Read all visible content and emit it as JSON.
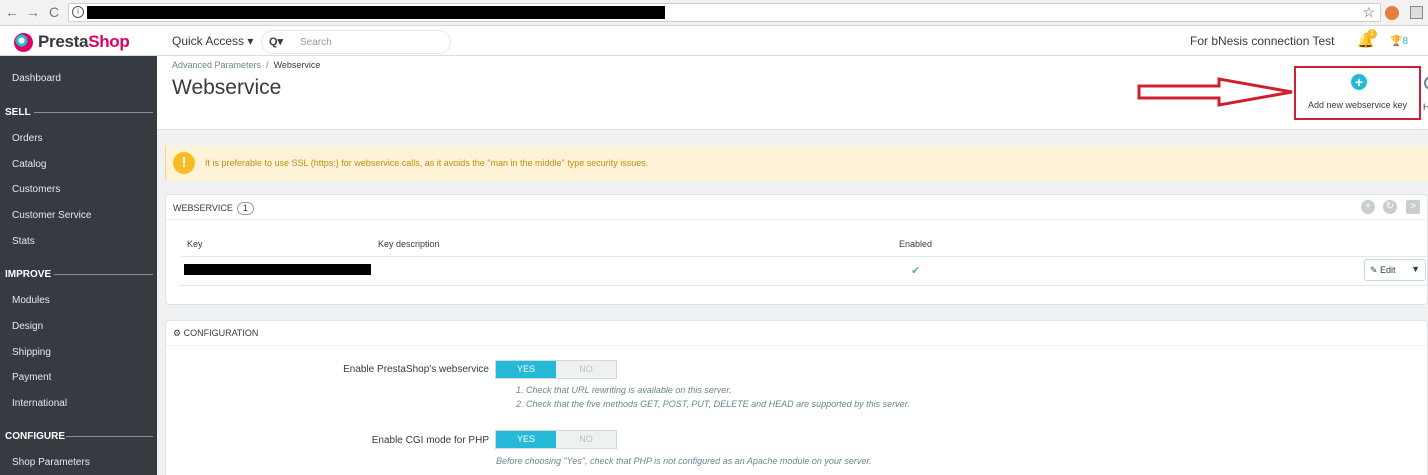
{
  "browser": {
    "back_icon": "←",
    "forward_icon": "→",
    "reload_icon": "C",
    "info_icon": "i",
    "star_icon": "☆"
  },
  "header": {
    "logo_presta": "Presta",
    "logo_shop": "Shop",
    "quick_access": "Quick Access ▾",
    "search_icon": "Q▾",
    "search_placeholder": "Search",
    "shop_name": "For bNesis connection Test",
    "bell_badge": "1",
    "trophy_count": "8"
  },
  "sidebar": {
    "dashboard": "Dashboard",
    "sections": [
      {
        "title": "SELL",
        "items": [
          "Orders",
          "Catalog",
          "Customers",
          "Customer Service",
          "Stats"
        ]
      },
      {
        "title": "IMPROVE",
        "items": [
          "Modules",
          "Design",
          "Shipping",
          "Payment",
          "International"
        ]
      },
      {
        "title": "CONFIGURE",
        "items": [
          "Shop Parameters"
        ]
      }
    ]
  },
  "page": {
    "breadcrumb_parent": "Advanced Parameters",
    "breadcrumb_sep": "/",
    "breadcrumb_current": "Webservice",
    "title": "Webservice",
    "add_key_label": "Add new webservice key",
    "help_stub": "H"
  },
  "alert": {
    "icon": "!",
    "text": "It is preferable to use SSL (https:) for webservice calls, as it avoids the \"man in the middle\" type security issues."
  },
  "webservice_panel": {
    "title": "WEBSERVICE",
    "count": "1",
    "columns": [
      "Key",
      "Key description",
      "Enabled"
    ],
    "row": {
      "enabled_icon": "✔"
    },
    "edit_label": "✎ Edit",
    "edit_caret": "▼"
  },
  "config_panel": {
    "title": "CONFIGURATION",
    "icon": "⚙",
    "fields": [
      {
        "label": "Enable PrestaShop's webservice",
        "yes": "YES",
        "no": "NO",
        "hints": [
          "1. Check that URL rewriting is available on this server.",
          "2. Check that the five methods GET, POST, PUT, DELETE and HEAD are supported by this server."
        ]
      },
      {
        "label": "Enable CGI mode for PHP",
        "yes": "YES",
        "no": "NO",
        "hints": [
          "Before choosing \"Yes\", check that PHP is not configured as an Apache module on your server."
        ]
      }
    ]
  }
}
